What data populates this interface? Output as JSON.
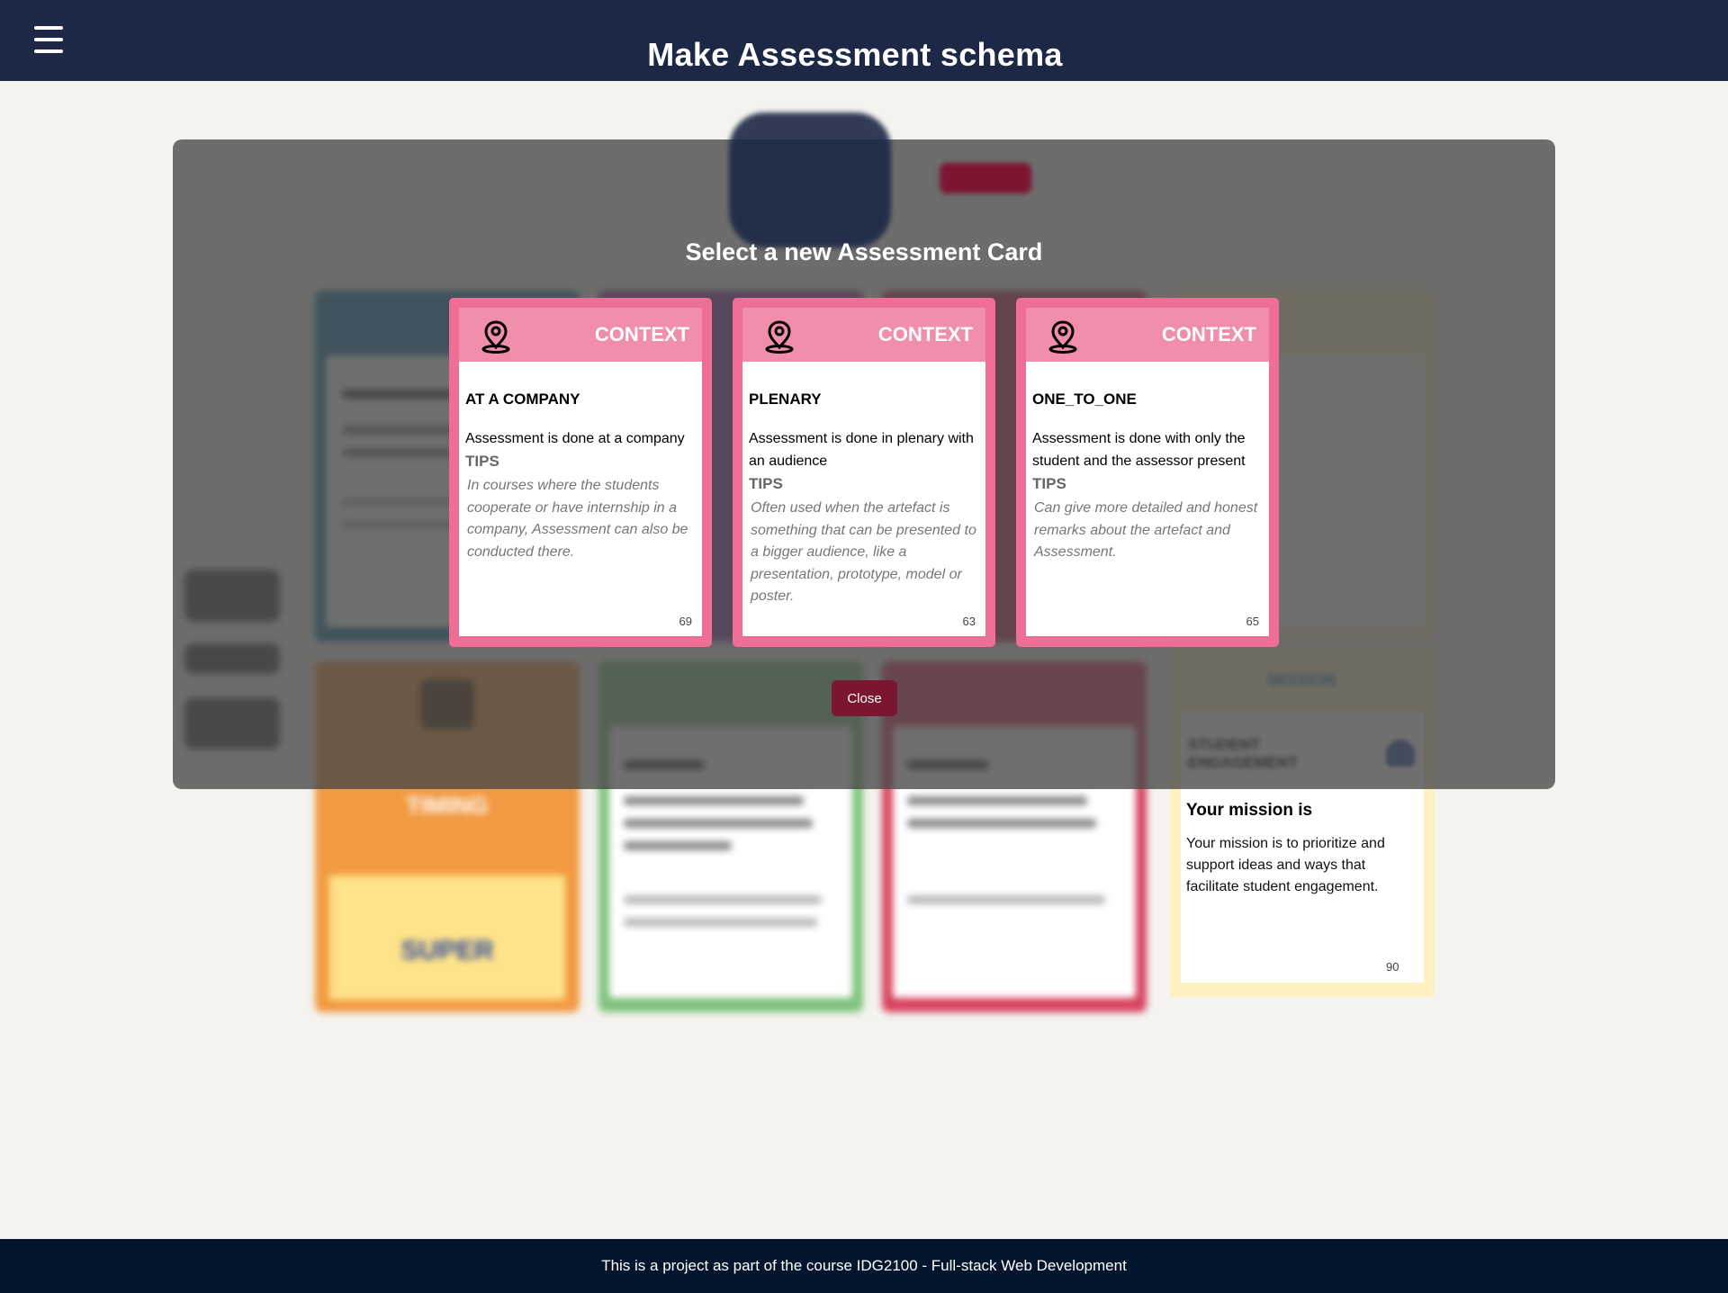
{
  "header": {
    "title": "Make Assessment schema",
    "menu_icon": "hamburger-icon"
  },
  "modal": {
    "title": "Select a new Assessment Card",
    "close_label": "Close",
    "cards": [
      {
        "category": "CONTEXT",
        "icon": "map-pin-icon",
        "title": "AT A COMPANY",
        "description": "Assessment is done at a company",
        "tips_label": "TIPS",
        "tips": "In courses where the students cooperate or have internship in a company, Assessment can also be conducted there.",
        "number": "69"
      },
      {
        "category": "CONTEXT",
        "icon": "map-pin-icon",
        "title": "PLENARY",
        "description": "Assessment is done in plenary with an audience",
        "tips_label": "TIPS",
        "tips": "Often used when the artefact is something that can be presented to a bigger audience, like a presentation, prototype, model or poster.",
        "number": "63"
      },
      {
        "category": "CONTEXT",
        "icon": "map-pin-icon",
        "title": "ONE_TO_ONE",
        "description": "Assessment is done with only the student and the assessor present",
        "tips_label": "TIPS",
        "tips": "Can give more detailed and honest remarks about the artefact and Assessment.",
        "number": "65"
      }
    ]
  },
  "mission_card": {
    "heading": "Your mission is",
    "text": "Your mission is to prioritize and support ideas and ways that facilitate student engagement.",
    "number": "90"
  },
  "footer": {
    "text": "This is a project as part of the course IDG2100 - Full-stack Web Development"
  },
  "colors": {
    "header_bg": "#1c2846",
    "footer_bg": "#04152e",
    "context_card": "#ee6e95",
    "context_header": "#f18eac",
    "close_button": "#7c1530",
    "page_bg": "#f4f3ef"
  }
}
